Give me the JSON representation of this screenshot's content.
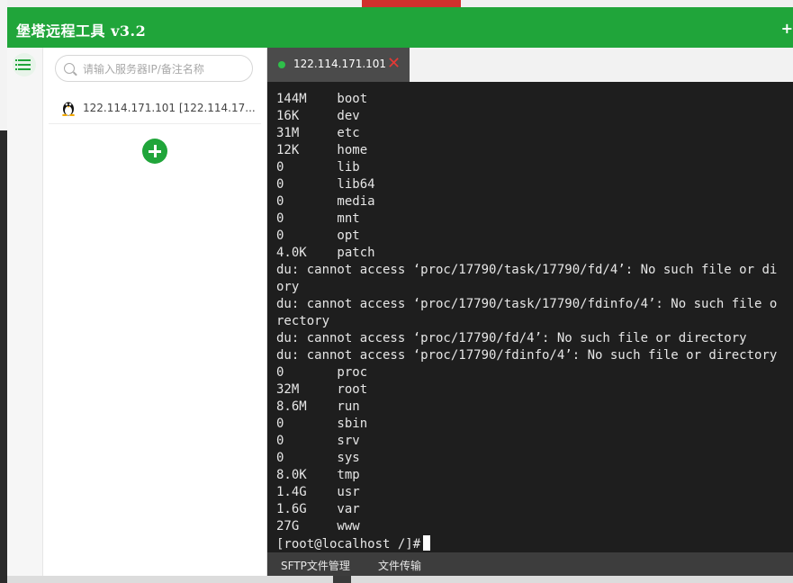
{
  "app": {
    "title": "堡塔远程工具 v3.2",
    "title_right_glyph": "+"
  },
  "sidebar": {
    "search": {
      "placeholder": "请输入服务器IP/备注名称",
      "value": ""
    },
    "servers": [
      {
        "label": "122.114.171.101 [122.114.17..."
      }
    ]
  },
  "tabs": [
    {
      "label": "122.114.171.101",
      "status": "connected"
    }
  ],
  "terminal": {
    "lines": [
      "144M    boot",
      "16K     dev",
      "31M     etc",
      "12K     home",
      "0       lib",
      "0       lib64",
      "0       media",
      "0       mnt",
      "0       opt",
      "4.0K    patch",
      "du: cannot access ‘proc/17790/task/17790/fd/4’: No such file or di",
      "ory",
      "du: cannot access ‘proc/17790/task/17790/fdinfo/4’: No such file o",
      "rectory",
      "du: cannot access ‘proc/17790/fd/4’: No such file or directory",
      "du: cannot access ‘proc/17790/fdinfo/4’: No such file or directory",
      "0       proc",
      "32M     root",
      "8.6M    run",
      "0       sbin",
      "0       srv",
      "0       sys",
      "8.0K    tmp",
      "1.4G    usr",
      "1.6G    var",
      "27G     www"
    ],
    "prompt": "[root@localhost /]#"
  },
  "statusbar": {
    "sftp_label": "SFTP文件管理",
    "transfer_label": "文件传输"
  },
  "colors": {
    "brand": "#20a53a",
    "terminal_bg": "#1e1e1e",
    "close_red": "#e53935",
    "status_green": "#2fbf4a"
  }
}
